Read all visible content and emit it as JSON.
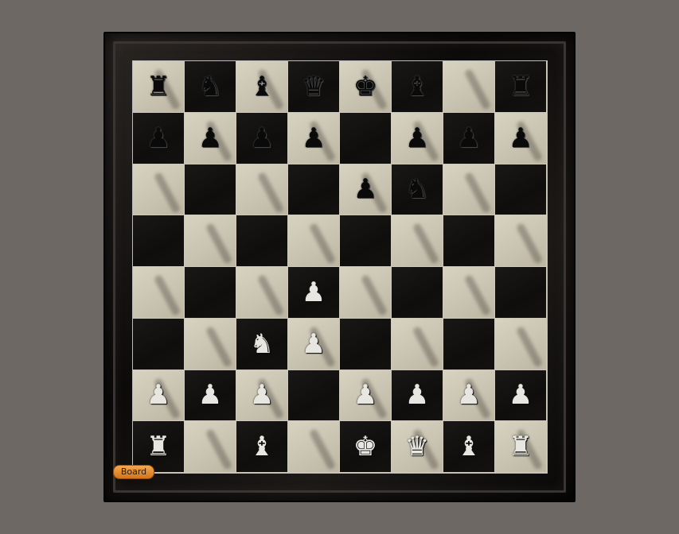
{
  "board_button": {
    "label": "Board"
  },
  "position": [
    [
      "br",
      "bn",
      "bb",
      "bq",
      "bk",
      "bb",
      "",
      "br"
    ],
    [
      "bp",
      "bp",
      "bp",
      "bp",
      "",
      "bp",
      "bp",
      "bp"
    ],
    [
      "",
      "",
      "",
      "",
      "bp",
      "bn",
      "",
      ""
    ],
    [
      "",
      "",
      "",
      "",
      "",
      "",
      "",
      ""
    ],
    [
      "",
      "",
      "",
      "wp",
      "",
      "",
      "",
      ""
    ],
    [
      "",
      "",
      "wn",
      "wp",
      "",
      "",
      "",
      ""
    ],
    [
      "wp",
      "wp",
      "wp",
      "",
      "wp",
      "wp",
      "wp",
      "wp"
    ],
    [
      "wr",
      "",
      "wb",
      "",
      "wk",
      "wq",
      "wb",
      "wr"
    ]
  ],
  "piece_glyphs": {
    "k": "♚",
    "q": "♛",
    "r": "♜",
    "b": "♝",
    "n": "♞",
    "p": "♟"
  },
  "piece_names": {
    "k": "king",
    "q": "queen",
    "r": "rook",
    "b": "bishop",
    "n": "knight",
    "p": "pawn"
  },
  "colors": {
    "light_square": "#d8d2c1",
    "dark_square": "#141210",
    "accent": "#e8912f"
  }
}
